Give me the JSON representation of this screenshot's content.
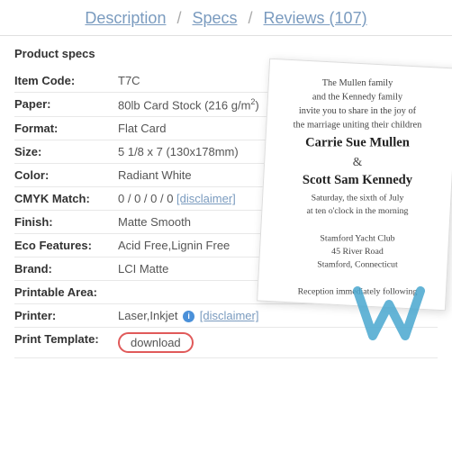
{
  "header": {
    "description_label": "Description",
    "specs_label": "Specs",
    "reviews_label": "Reviews (107)",
    "separator": "/"
  },
  "section": {
    "title": "Product specs"
  },
  "specs": [
    {
      "label": "Item Code:",
      "value": "T7C",
      "has_link": false
    },
    {
      "label": "Paper:",
      "value": "80lb Card Stock (216 g/m²)",
      "has_link": false
    },
    {
      "label": "Format:",
      "value": "Flat Card",
      "has_link": false
    },
    {
      "label": "Size:",
      "value": "5 1/8 x 7 (130x178mm)",
      "has_link": false
    },
    {
      "label": "Color:",
      "value": "Radiant White",
      "has_link": false
    },
    {
      "label": "CMYK Match:",
      "value": "0 / 0 / 0 / 0",
      "link_text": "[disclaimer]",
      "has_link": true
    },
    {
      "label": "Finish:",
      "value": "Matte Smooth",
      "has_link": false
    },
    {
      "label": "Eco Features:",
      "value": "Acid Free,Lignin Free",
      "has_link": false
    },
    {
      "label": "Brand:",
      "value": "LCI Matte",
      "has_link": false
    },
    {
      "label": "Printable Area:",
      "value": "",
      "has_link": false
    },
    {
      "label": "Printer:",
      "value": "Laser,Inkjet",
      "link_text": "[disclaimer]",
      "has_info_icon": true,
      "has_link": true
    },
    {
      "label": "Print Template:",
      "value": "",
      "download_label": "download",
      "has_download": true
    }
  ],
  "card_preview": {
    "intro": "The Mullen family\nand the Kennedy family\ninvite you to share in the joy of\nthe marriage uniting their children",
    "name1": "Carrie Sue Mullen",
    "ampersand": "&",
    "name2": "Scott Sam Kennedy",
    "detail1": "Saturday, the sixth of July",
    "detail2": "at ten o'clock in the morning",
    "venue": "Stamford Yacht Club",
    "address1": "45 River Road",
    "address2": "Stamford, Connecticut",
    "closing": "Reception immediately following"
  }
}
